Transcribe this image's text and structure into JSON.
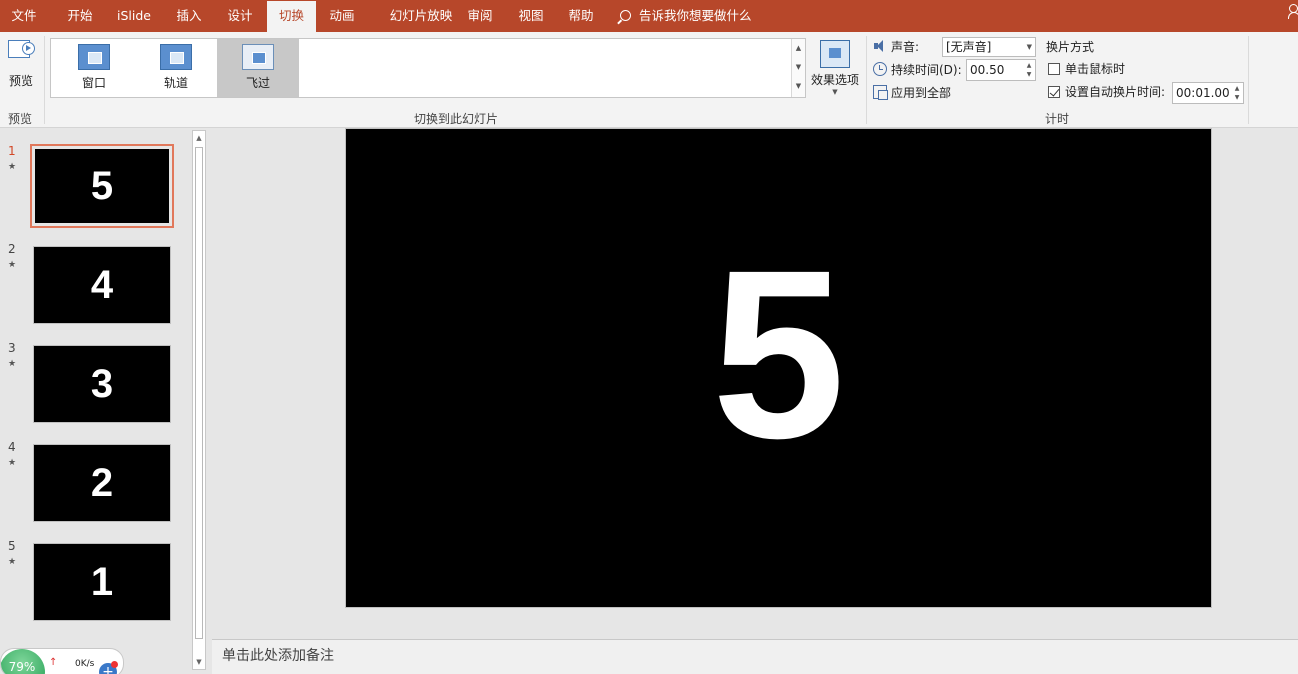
{
  "tabs": [
    "文件",
    "开始",
    "iSlide",
    "插入",
    "设计",
    "切换",
    "动画",
    "幻灯片放映",
    "审阅",
    "视图",
    "帮助"
  ],
  "active_tab": "切换",
  "tell_me": "告诉我你想要做什么",
  "ribbon": {
    "preview": {
      "button": "预览",
      "group": "预览"
    },
    "transitions": {
      "items": [
        {
          "label": "窗口",
          "selected": false
        },
        {
          "label": "轨道",
          "selected": false
        },
        {
          "label": "飞过",
          "selected": true
        }
      ],
      "effect_options": "效果选项",
      "group": "切换到此幻灯片"
    },
    "timing": {
      "sound_label": "声音:",
      "sound_value": "[无声音]",
      "duration_label": "持续时间(D):",
      "duration_value": "00.50",
      "apply_all": "应用到全部",
      "advance_title": "换片方式",
      "on_click_label": "单击鼠标时",
      "on_click_checked": false,
      "after_label": "设置自动换片时间:",
      "after_checked": true,
      "after_value": "00:01.00",
      "group": "计时"
    }
  },
  "thumbnails": [
    {
      "num": "1",
      "star": "★",
      "content": "5",
      "selected": true
    },
    {
      "num": "2",
      "star": "★",
      "content": "4",
      "selected": false
    },
    {
      "num": "3",
      "star": "★",
      "content": "3",
      "selected": false
    },
    {
      "num": "4",
      "star": "★",
      "content": "2",
      "selected": false
    },
    {
      "num": "5",
      "star": "★",
      "content": "1",
      "selected": false
    }
  ],
  "slide": {
    "content": "5"
  },
  "notes_placeholder": "单击此处添加备注",
  "widget": {
    "percent": "79%",
    "speed": "0K/s",
    "plus": "+"
  },
  "colors": {
    "accent": "#b7472a",
    "selection": "#e1785b",
    "slide_bg": "#000000",
    "slide_text": "#ffffff"
  }
}
